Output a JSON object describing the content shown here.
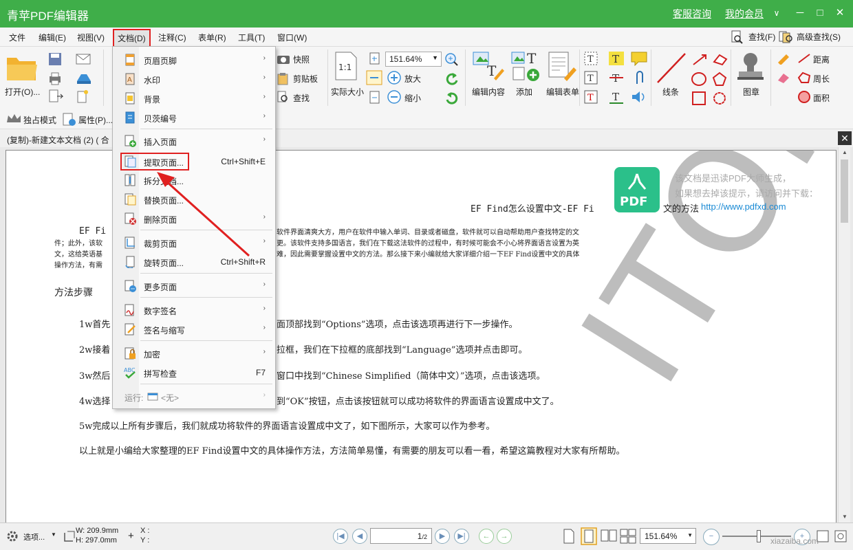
{
  "window": {
    "title": "青苹PDF编辑器",
    "links": [
      "客服咨询",
      "我的会员"
    ],
    "controls": {
      "menu": "∨",
      "minimize": "─",
      "maximize": "□",
      "close": "✕"
    }
  },
  "menubar": {
    "items": [
      "文件",
      "编辑(E)",
      "视图(V)",
      "文档(D)",
      "注释(C)",
      "表单(R)",
      "工具(T)",
      "窗口(W)"
    ],
    "active_index": 3,
    "search": "查找(F)",
    "advanced_search": "高级查找(S)"
  },
  "toolbar": {
    "open": "打开(O)...",
    "snapshot": "快照",
    "clipboard": "剪贴板",
    "find": "查找",
    "zoom_value": "151.64%",
    "zoom_in": "放大",
    "zoom_out": "缩小",
    "actual_size_icon": "1:1",
    "actual_size": "实际大小",
    "edit_content": "编辑内容",
    "add": "添加",
    "edit_form": "编辑表单",
    "lines": "线条",
    "stamp": "图章",
    "distance": "距离",
    "perimeter": "周长",
    "area": "面积"
  },
  "toolbar2": {
    "exclusive_mode": "独占模式",
    "properties": "属性(P)..."
  },
  "tab": {
    "title": "(复制)-新建文本文档 (2) ( 合",
    "close": "✕"
  },
  "dropdown": {
    "items": [
      {
        "label": "页眉页脚",
        "shortcut": "",
        "submenu": true
      },
      {
        "label": "水印",
        "shortcut": "",
        "submenu": true
      },
      {
        "label": "背景",
        "shortcut": "",
        "submenu": true
      },
      {
        "label": "贝茨编号",
        "shortcut": "",
        "submenu": true
      },
      {
        "label": "插入页面",
        "shortcut": "",
        "submenu": true
      },
      {
        "label": "提取页面...",
        "shortcut": "Ctrl+Shift+E",
        "submenu": false
      },
      {
        "label": "拆分文档...",
        "shortcut": "",
        "submenu": false
      },
      {
        "label": "替换页面...",
        "shortcut": "",
        "submenu": false
      },
      {
        "label": "删除页面",
        "shortcut": "",
        "submenu": true
      },
      {
        "label": "裁剪页面",
        "shortcut": "",
        "submenu": true
      },
      {
        "label": "旋转页面...",
        "shortcut": "Ctrl+Shift+R",
        "submenu": false
      },
      {
        "label": "更多页面",
        "shortcut": "",
        "submenu": true
      },
      {
        "label": "数字签名",
        "shortcut": "",
        "submenu": true
      },
      {
        "label": "签名与缩写",
        "shortcut": "",
        "submenu": true
      },
      {
        "label": "加密",
        "shortcut": "",
        "submenu": true
      },
      {
        "label": "拼写检查",
        "shortcut": "F7",
        "submenu": false
      },
      {
        "label": "运行:",
        "shortcut": "",
        "submenu": true
      }
    ],
    "run_value": "<无>",
    "spell_icon": "ABC",
    "arrow": "›"
  },
  "document": {
    "title": "EF Find怎么设置中文-EF Fi",
    "title_tail": "文的方法",
    "intro_lines": [
      "EF Fi",
      "件；此外，该软",
      "文，这给英语基",
      "操作方法，有需"
    ],
    "intro_right": [
      "软件界面清爽大方，用户在软件中输入单词、目录或者磁盘，软件就可以自动帮助用户查找特定的文",
      "更。该软件支持多国语言，我们在下载这法软件的过程中，有时候可能会不小心将界面语言设置为英",
      "难，因此需要掌握设置中文的方法。那么接下来小编就给大家详细介绍一下EF Find设置中文的具体"
    ],
    "heading": "方法步骤",
    "steps_left": [
      "1w首先",
      "2w接着",
      "3w然后",
      "4w选择"
    ],
    "steps_right": [
      "面顶部找到“Options”选项，点击该选项再进行下一步操作。",
      "拉框，我们在下拉框的底部找到“Language”选项并点击即可。",
      "窗口中找到“Chinese Simplified（简体中文）”选项，点击该选项。",
      "到“OK”按钮，点击该按钮就可以成功将软件的界面语言设置成中文了。"
    ],
    "step5": "5w完成以上所有步骤后，我们就成功将软件的界面语言设置成中文了，如下图所示，大家可以作为参考。",
    "conclusion": "以上就是小编给大家整理的EF Find设置中文的具体操作方法，方法简单易懂，有需要的朋友可以看一看，希望这篇教程对大家有所帮助。",
    "watermark": {
      "logo_text": "PDF",
      "line1": "该文档是迅读PDF大师生成，",
      "line2": "如果想去掉该提示，请访问并下载：",
      "url": "http://www.pdfxd.com",
      "big": "ITOR"
    }
  },
  "statusbar": {
    "options": "选项...",
    "width": "W: 209.9mm",
    "height": "H: 297.0mm",
    "x": "X :",
    "y": "Y :",
    "page": "1",
    "total": "/2",
    "zoom": "151.64%",
    "site_watermark": "xiazaiba.com"
  },
  "colors": {
    "brand_green": "#3fae49",
    "highlight_red": "#e02020",
    "pdf_logo": "#2bc08a"
  }
}
